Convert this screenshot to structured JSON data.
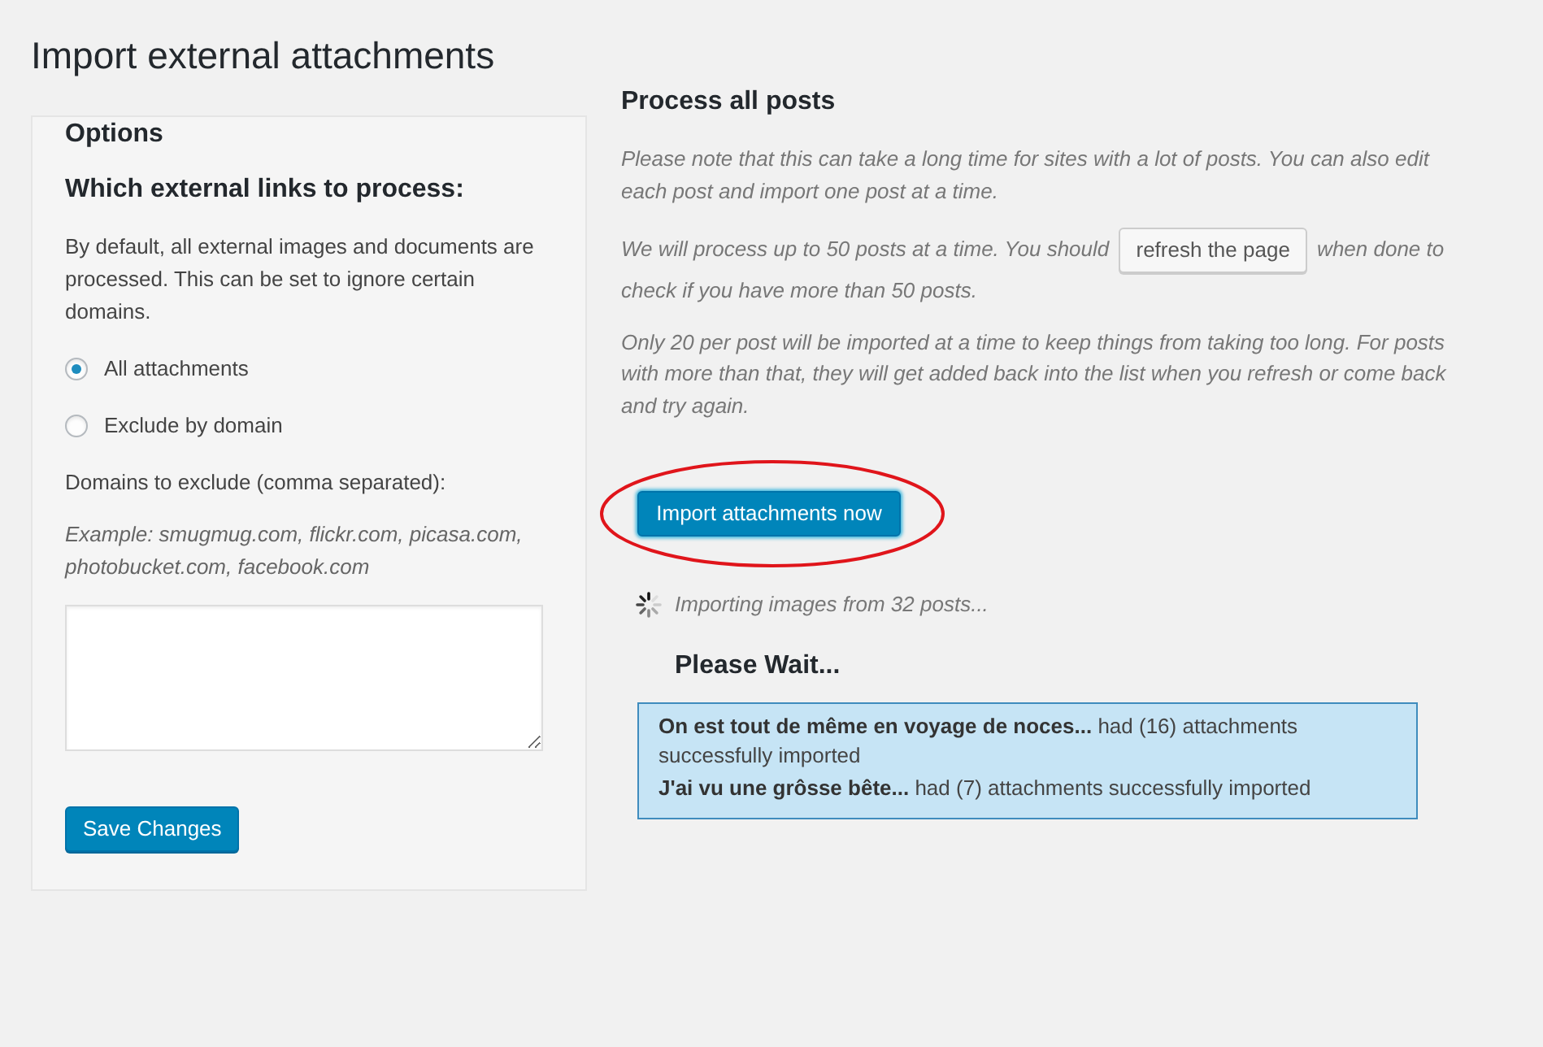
{
  "page": {
    "title": "Import external attachments"
  },
  "options_panel": {
    "heading": "Options",
    "subheading": "Which external links to process:",
    "description": "By default, all external images and documents are processed. This can be set to ignore certain domains.",
    "radios": [
      {
        "label": "All attachments",
        "selected": true
      },
      {
        "label": "Exclude by domain",
        "selected": false
      }
    ],
    "domains_label": "Domains to exclude (comma separated):",
    "example": "Example: smugmug.com, flickr.com, picasa.com, photobucket.com, facebook.com",
    "save_button": "Save Changes"
  },
  "process_panel": {
    "heading": "Process all posts",
    "notes": [
      {
        "kind": "text",
        "text": "Please note that this can take a long time for sites with a lot of posts. You can also edit each post and import one post at a time."
      },
      {
        "kind": "text_with_button",
        "before": "We will process up to 50 posts at a time. You should",
        "button": "refresh the page",
        "after": "when done to check if you have more than 50 posts."
      },
      {
        "kind": "text",
        "text": "Only 20 per post will be imported at a time to keep things from taking too long. For posts with more than that, they will get added back into the list when you refresh or come back and try again."
      }
    ],
    "import_button": {
      "label": "Import attachments now",
      "highlighted": true
    },
    "progress": {
      "text": "Importing images from 32 posts..."
    },
    "wait_heading": "Please Wait...",
    "results": [
      "**On est tout de même en voyage de noces...** had (16) attachments successfully imported",
      "**J'ai vu une grôsse bête...** had (7) attachments successfully imported"
    ]
  }
}
